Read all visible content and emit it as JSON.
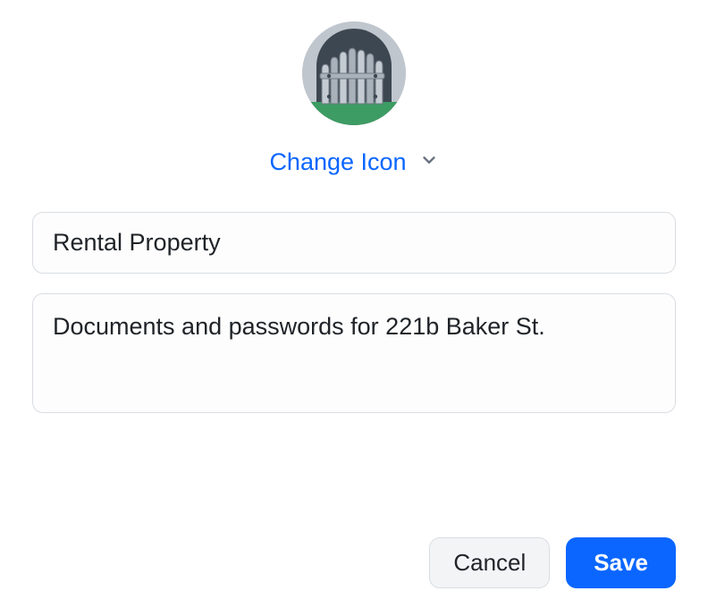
{
  "icon": {
    "name": "gate-icon",
    "colors": {
      "circle_bg": "#c0c6cd",
      "sky": "#3d4752",
      "metal_light": "#c4cbd2",
      "metal_dark": "#a9b1ba",
      "metal_outline": "#6e7882",
      "grass": "#3d9c63"
    }
  },
  "change_icon_label": "Change Icon",
  "name_field": {
    "value": "Rental Property",
    "placeholder": ""
  },
  "description_field": {
    "value": "Documents and passwords for 221b Baker St.",
    "placeholder": ""
  },
  "buttons": {
    "cancel": "Cancel",
    "save": "Save"
  },
  "accent_color": "#0a66ff"
}
